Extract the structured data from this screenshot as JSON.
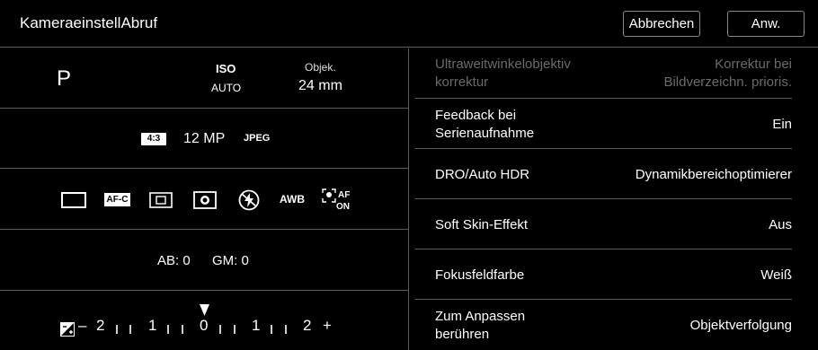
{
  "header": {
    "title": "KameraeinstellAbruf",
    "cancel_label": "Abbrechen",
    "apply_label": "Anw."
  },
  "left": {
    "row1": {
      "mode": "P",
      "iso_label": "ISO",
      "iso_value": "AUTO",
      "lens_label": "Objek.",
      "lens_value": "24 mm"
    },
    "row2": {
      "aspect": "4:3",
      "size": "12 MP",
      "format": "JPEG"
    },
    "row3": {
      "icons": [
        "drive-single-icon",
        "af-c-icon",
        "focus-area-icon",
        "metering-icon",
        "flash-off-icon",
        "awb-icon",
        "face-af-on-icon"
      ],
      "af_label": "AF-C",
      "awb_label": "AWB"
    },
    "row4": {
      "ab": "AB: 0",
      "gm": "GM: 0"
    },
    "row5": {
      "ev_minus": "–",
      "ev_scale": [
        "2",
        "1",
        "0",
        "1",
        "2"
      ],
      "ev_plus": "+"
    }
  },
  "settings": [
    {
      "label_1": "Ultraweitwinkelobjektiv",
      "label_2": "korrektur",
      "value_1": "Korrektur bei",
      "value_2": "Bildverzeichn. prioris.",
      "disabled": true
    },
    {
      "label_1": "Feedback bei",
      "label_2": "Serienaufnahme",
      "value_1": "Ein",
      "value_2": ""
    },
    {
      "label_1": "DRO/Auto HDR",
      "label_2": "",
      "value_1": "Dynamikbereichoptimierer",
      "value_2": ""
    },
    {
      "label_1": "Soft Skin-Effekt",
      "label_2": "",
      "value_1": "Aus",
      "value_2": ""
    },
    {
      "label_1": "Fokusfeldfarbe",
      "label_2": "",
      "value_1": "Weiß",
      "value_2": ""
    },
    {
      "label_1": "Zum Anpassen",
      "label_2": "berühren",
      "value_1": "Objektverfolgung",
      "value_2": ""
    }
  ]
}
